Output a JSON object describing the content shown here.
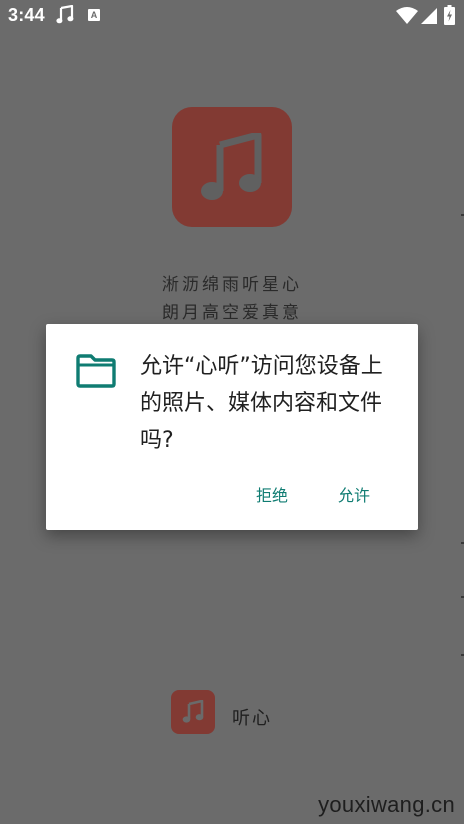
{
  "status_bar": {
    "time": "3:44",
    "icons": [
      "music-note-icon",
      "a-icon",
      "wifi-icon",
      "signal-icon",
      "battery-icon"
    ]
  },
  "splash": {
    "logo_icon": "music-note-icon",
    "slogan_line1": "淅沥绵雨听星心",
    "slogan_line2": "朗月高空爱真意",
    "logo_color": "#823a33"
  },
  "dialog": {
    "icon": "folder-icon",
    "message": "允许“心听”访问您设备上的照片、媒体内容和文件吗?",
    "deny_label": "拒绝",
    "allow_label": "允许",
    "accent_color": "#0f7c72"
  },
  "footer": {
    "logo_icon": "music-note-icon",
    "app_name": "听心"
  },
  "watermark": {
    "text": "youxiwang.cn"
  }
}
